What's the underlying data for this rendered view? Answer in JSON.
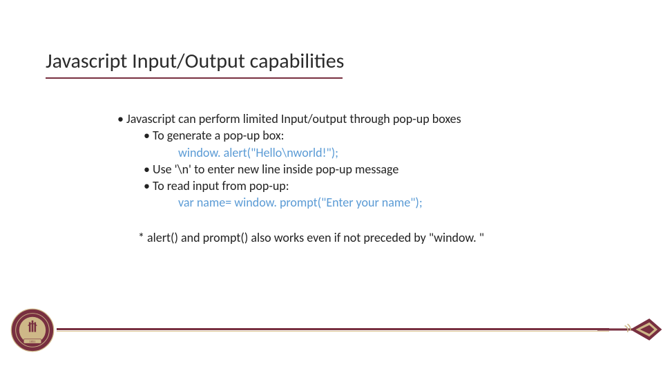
{
  "title": "Javascript Input/Output capabilities",
  "bullets": {
    "b1": "• Javascript can perform limited Input/output through pop-up boxes",
    "b2": "• To generate a pop-up box:",
    "c1": "window. alert(\"Hello\\nworld!\");",
    "b3": "• Use '\\n' to enter new line inside pop-up message",
    "b4": "• To read input from pop-up:",
    "c2": "var name= window. prompt(\"Enter your name\");"
  },
  "note": "* alert() and prompt() also works even if not preceded by \"window. \"",
  "brand": {
    "color": "#782f40",
    "gold": "#ceb888",
    "seal_text_top": "FLORIDA STATE UNIVERSITY",
    "seal_year": "1851"
  }
}
